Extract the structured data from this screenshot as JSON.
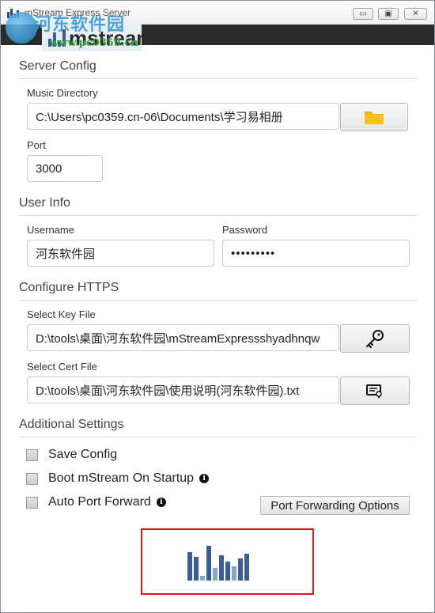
{
  "window": {
    "title": "mStream Express Server",
    "controls": {
      "minimize": "▭",
      "maximize": "▣",
      "close": "✕"
    }
  },
  "watermark": {
    "text": "河东软件园",
    "url": "www.pc0359.cn"
  },
  "header": {
    "logo_text": "mstream"
  },
  "server_config": {
    "title": "Server Config",
    "music_directory_label": "Music Directory",
    "music_directory_value": "C:\\Users\\pc0359.cn-06\\Documents\\学习易相册",
    "folder_icon": "folder-icon",
    "port_label": "Port",
    "port_value": "3000"
  },
  "user_info": {
    "title": "User Info",
    "username_label": "Username",
    "username_value": "河东软件园",
    "password_label": "Password",
    "password_value": "•••••••••"
  },
  "https": {
    "title": "Configure HTTPS",
    "key_label": "Select Key File",
    "key_value": "D:\\tools\\桌面\\河东软件园\\mStreamExpressshyadhnqw",
    "key_icon": "key-icon",
    "cert_label": "Select Cert File",
    "cert_value": "D:\\tools\\桌面\\河东软件园\\使用说明(河东软件园).txt",
    "cert_icon": "certificate-icon"
  },
  "additional": {
    "title": "Additional Settings",
    "save_config": "Save Config",
    "boot_on_startup": "Boot mStream On Startup",
    "auto_port_forward": "Auto Port Forward",
    "port_forwarding_button": "Port Forwarding Options",
    "info_glyph": "i"
  },
  "colors": {
    "folder": "#f5b400",
    "logo_bars": "#3c5c96",
    "highlight": "#d11a1a",
    "header_bg": "#2b2b2b"
  }
}
